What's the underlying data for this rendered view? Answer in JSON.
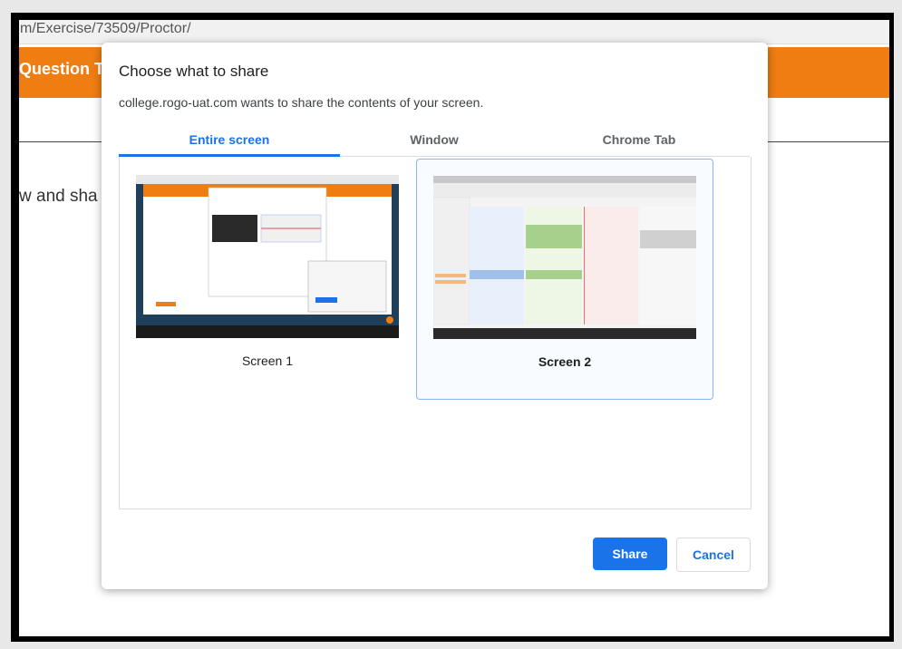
{
  "background_page": {
    "url_text": "m/Exercise/73509/Proctor/",
    "header_text": "Question Ty",
    "body_text": "w and sha",
    "header_color": "#ef7d12"
  },
  "dialog": {
    "title": "Choose what to share",
    "subtitle": "college.rogo-uat.com wants to share the contents of your screen.",
    "tabs": [
      {
        "label": "Entire screen",
        "active": true
      },
      {
        "label": "Window",
        "active": false
      },
      {
        "label": "Chrome Tab",
        "active": false
      }
    ],
    "screens": [
      {
        "label": "Screen 1",
        "selected": false
      },
      {
        "label": "Screen 2",
        "selected": true
      }
    ],
    "share_label": "Share",
    "cancel_label": "Cancel",
    "accent_color": "#1a73e8"
  }
}
